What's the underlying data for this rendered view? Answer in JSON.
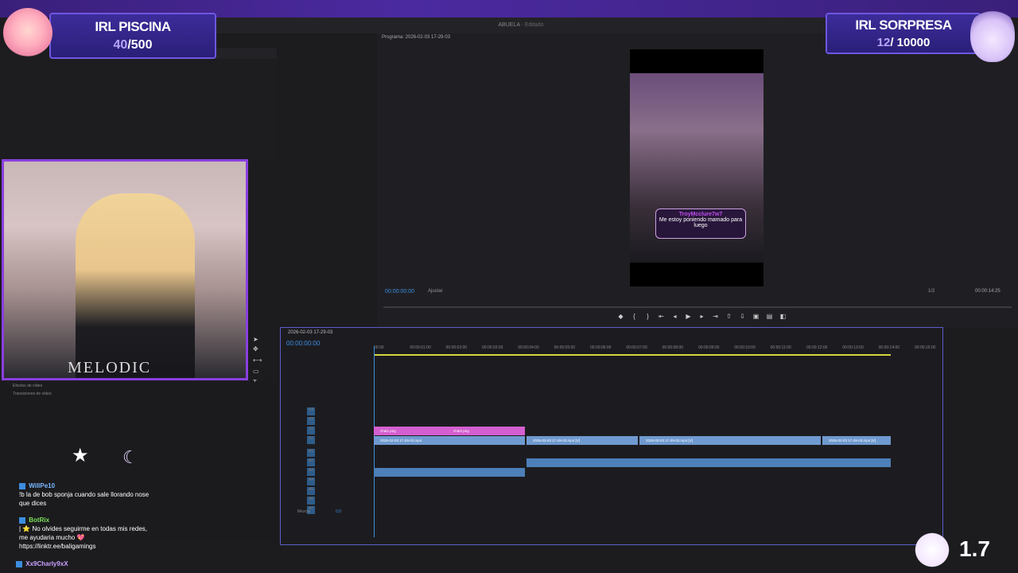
{
  "overlay": {
    "left_counter": {
      "title": "IRL PISCINA",
      "current": "40",
      "total": "/500"
    },
    "right_counter": {
      "title": "IRL SORPRESA",
      "current": "12",
      "total": "/ 10000"
    },
    "version": "1.7"
  },
  "editor": {
    "window_title": "ABUELA",
    "window_subtitle": "- Editado",
    "program_label": "Programa: 2026-02-03 17-29-03",
    "program_timecode": "00:00:00:00",
    "fit_label": "Ajustar",
    "resolution_fraction": "1/2",
    "program_duration": "00:00:14:25",
    "sequence_tab": "2026-02-03 17-29-03",
    "sequence_timecode": "00:00:00:00",
    "ruler_ticks": [
      "00:00",
      "00:00:01:00",
      "00:00:02:00",
      "00:00:03:00",
      "00:00:04:00",
      "00:00:05:00",
      "00:00:06:00",
      "00:00:07:00",
      "00:00:08:00",
      "00:00:09:00",
      "00:00:10:00",
      "00:00:11:00",
      "00:00:12:00",
      "00:00:13:00",
      "00:00:14:00",
      "00:00:15:00"
    ],
    "video_tracks": [
      "V4",
      "V3",
      "V2",
      "V1"
    ],
    "audio_tracks": [
      "A1",
      "A2",
      "A3",
      "A4",
      "A5",
      "A6",
      "A7"
    ],
    "mix_label": "Mezcla",
    "mix_value": "0,0",
    "clips_v2": [
      "chat1.png",
      "chat2.png"
    ],
    "clips_v1": [
      "2026-02-03 17-29-03.mp4",
      "2026-02-03 17-29-03.mp4 [V]",
      "2026-02-03 17-29-03.mp4 [V]",
      "2026-02-03 17-29-03.mp4 [V]"
    ],
    "effects_items": [
      "Efectos de vídeo",
      "Transiciones de vídeo"
    ]
  },
  "video_overlay": {
    "username": "TroyMcclure7w7",
    "message": "Me estoy poniendo mamado para luego"
  },
  "webcam": {
    "shirt_text": "MELODIC"
  },
  "chat": [
    {
      "user": "WillPe10",
      "text": "!b la de bob sponja cuando sale llorando nose que dices"
    },
    {
      "user": "BotRix",
      "text": "| ⭐ No olvides seguirme en todas mis redes, me ayudaria mucho 💖 https://linktr.ee/baligamings"
    },
    {
      "user": "Xx9Charly9xX",
      "text": ""
    }
  ],
  "colors": {
    "accent_blue": "#3b8de0",
    "counter_purple": "#6e57e0",
    "clip_pink": "#d45fd0",
    "clip_blue": "#6f9ad0",
    "webcam_border": "#8a3fe0"
  }
}
